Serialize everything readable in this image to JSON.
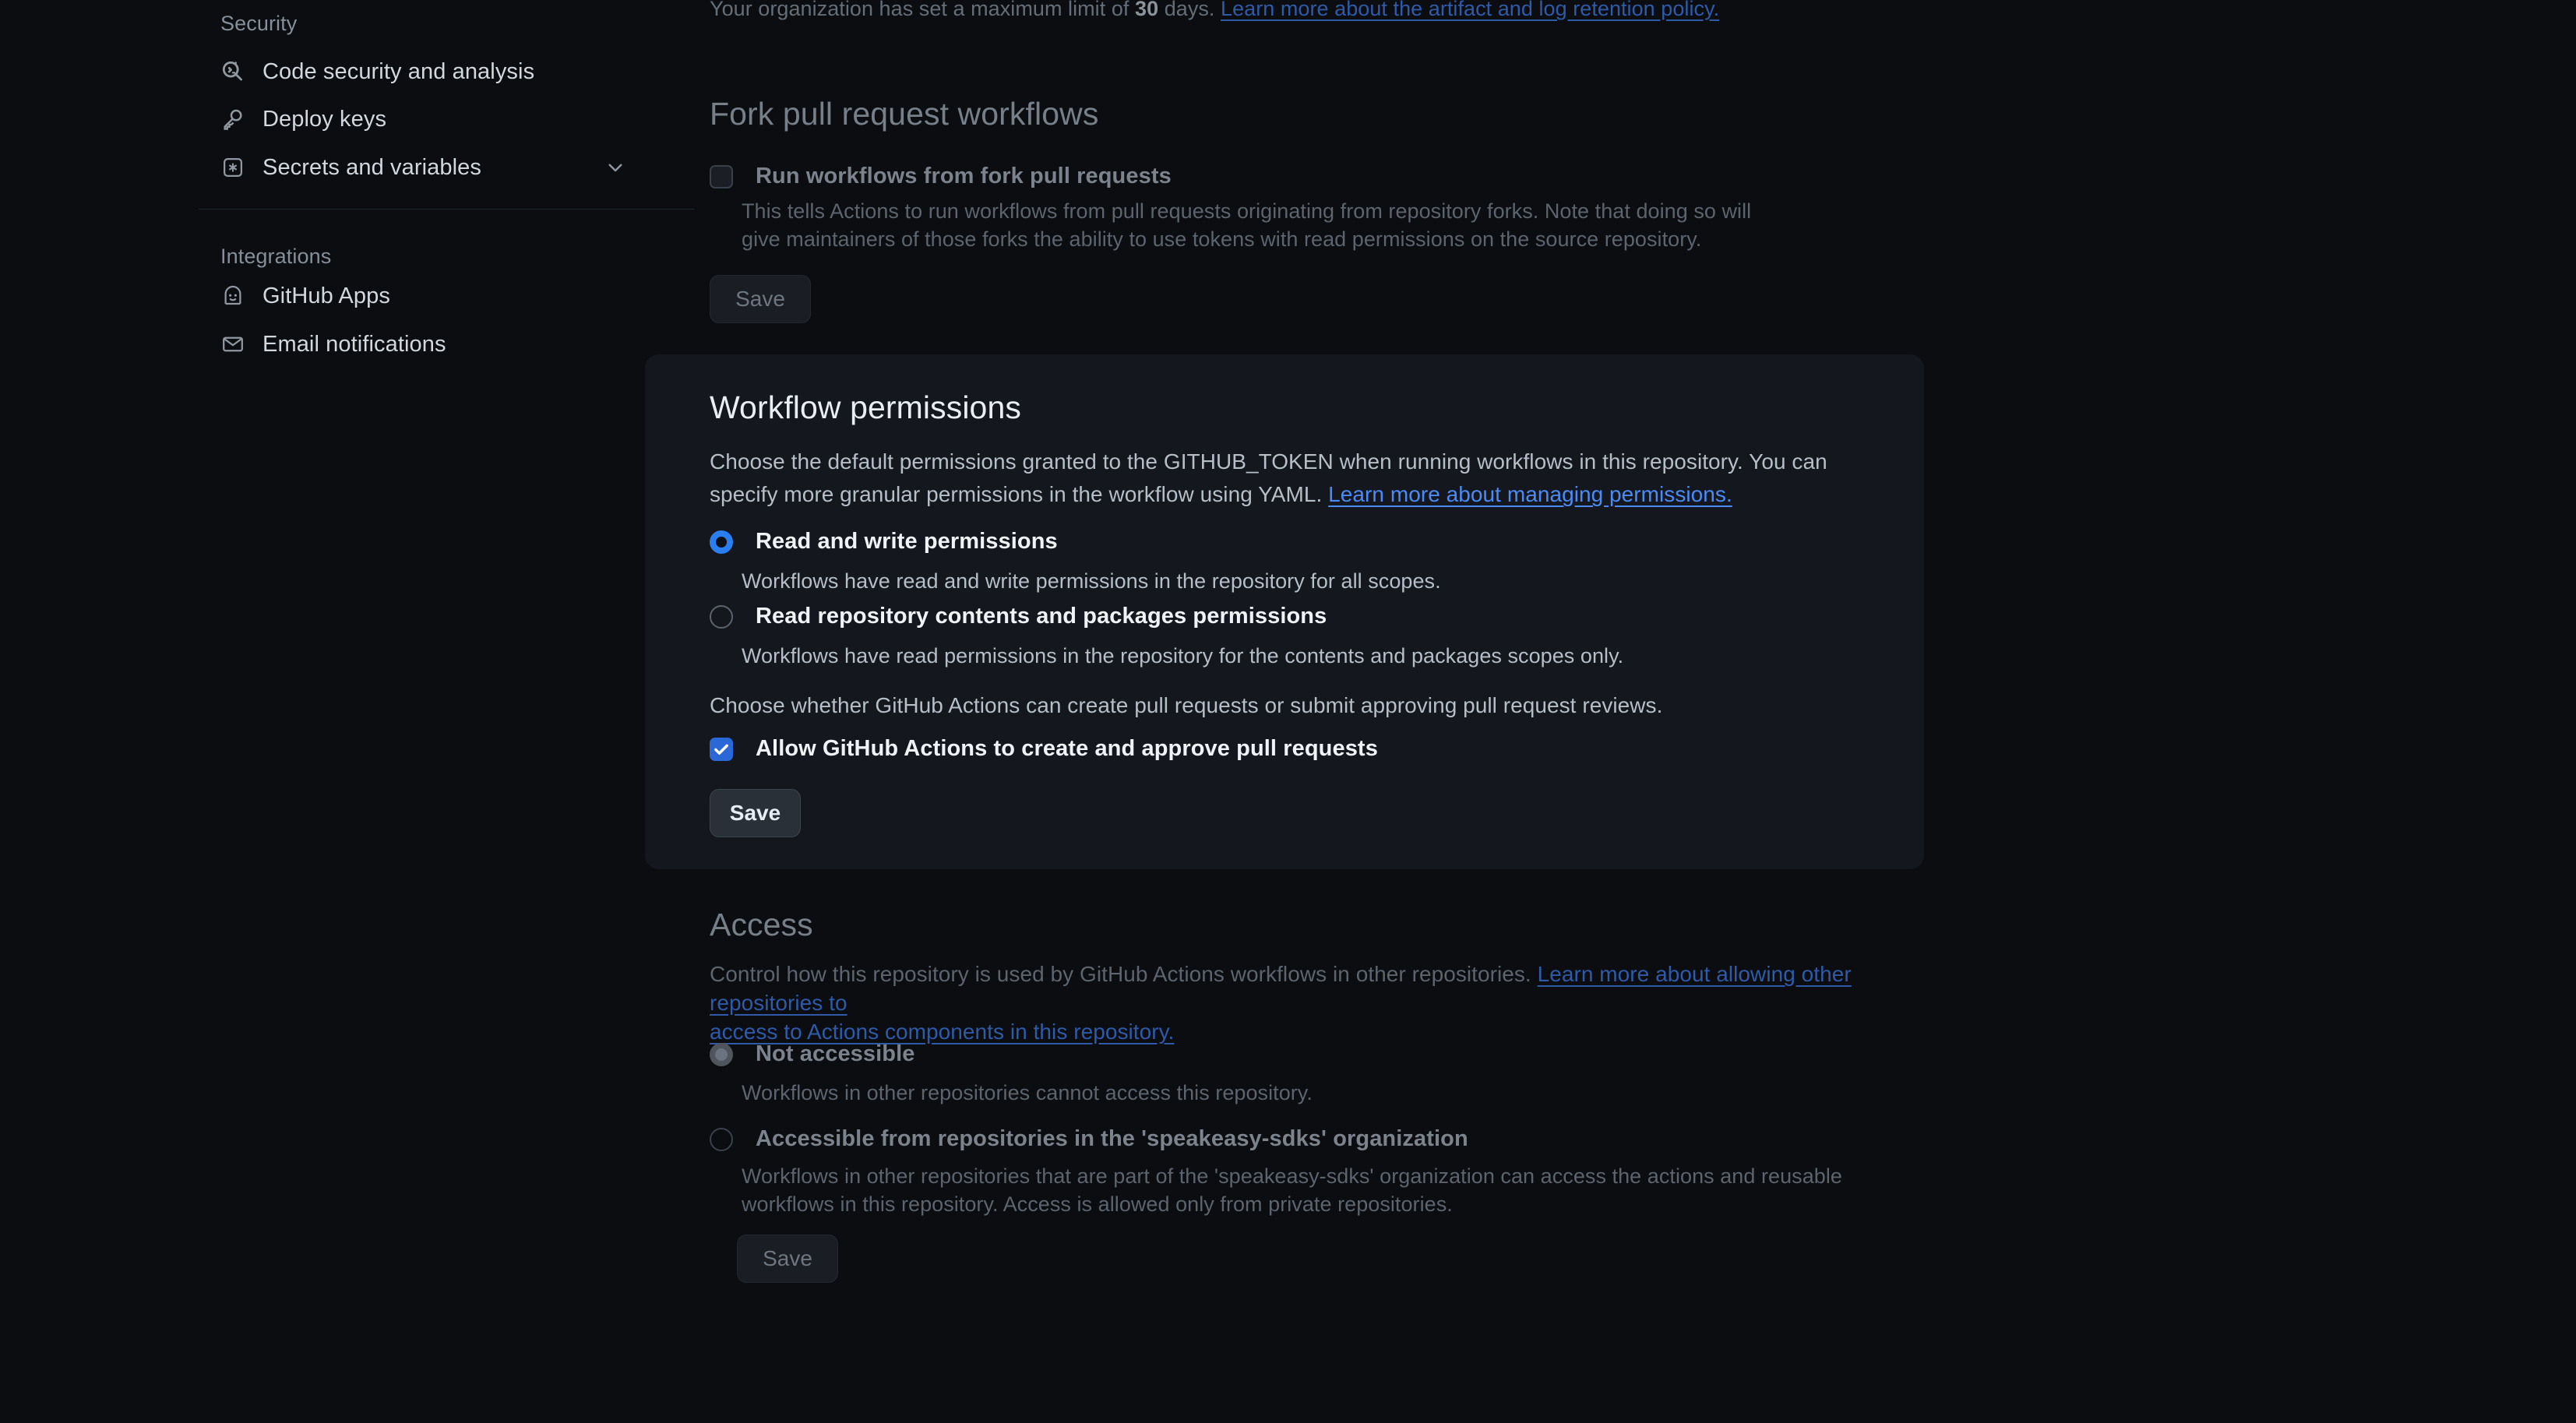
{
  "sidebar": {
    "groups": [
      {
        "title": "Security",
        "items": [
          {
            "label": "Code security and analysis",
            "icon": "code-scan-icon",
            "expandable": false
          },
          {
            "label": "Deploy keys",
            "icon": "key-icon",
            "expandable": false
          },
          {
            "label": "Secrets and variables",
            "icon": "asterisk-key-icon",
            "expandable": true
          }
        ]
      },
      {
        "title": "Integrations",
        "items": [
          {
            "label": "GitHub Apps",
            "icon": "github-app-icon",
            "expandable": false
          },
          {
            "label": "Email notifications",
            "icon": "mail-icon",
            "expandable": false
          }
        ]
      }
    ]
  },
  "retention": {
    "text_before": "Your organization has set a maximum limit of ",
    "days": "30",
    "text_after": " days. ",
    "link": "Learn more about the artifact and log retention policy."
  },
  "fork_section": {
    "heading": "Fork pull request workflows",
    "checkbox_label": "Run workflows from fork pull requests",
    "checkbox_checked": false,
    "description_line1": "This tells Actions to run workflows from pull requests originating from repository forks. Note that doing so will",
    "description_line2": "give maintainers of those forks the ability to use tokens with read permissions on the source repository.",
    "save_label": "Save"
  },
  "workflow_permissions": {
    "heading": "Workflow permissions",
    "description_line1": "Choose the default permissions granted to the GITHUB_TOKEN when running workflows in this repository. You can",
    "description_line2_before": "specify more granular permissions in the workflow using YAML. ",
    "description_link": "Learn more about managing permissions.",
    "options": [
      {
        "label": "Read and write permissions",
        "description": "Workflows have read and write permissions in the repository for all scopes.",
        "selected": true
      },
      {
        "label": "Read repository contents and packages permissions",
        "description": "Workflows have read permissions in the repository for the contents and packages scopes only.",
        "selected": false
      }
    ],
    "pr_prompt": "Choose whether GitHub Actions can create pull requests or submit approving pull request reviews.",
    "pr_checkbox_label": "Allow GitHub Actions to create and approve pull requests",
    "pr_checkbox_checked": true,
    "save_label": "Save"
  },
  "access_section": {
    "heading": "Access",
    "description_before": "Control how this repository is used by GitHub Actions workflows in other repositories. ",
    "description_link_line1": "Learn more about allowing other repositories to",
    "description_link_line2": "access to Actions components in this repository.",
    "options": [
      {
        "label": "Not accessible",
        "description_line1": "Workflows in other repositories cannot access this repository.",
        "description_line2": "",
        "selected": true
      },
      {
        "label": "Accessible from repositories in the 'speakeasy-sdks' organization",
        "description_line1": "Workflows in other repositories that are part of the 'speakeasy-sdks' organization can access the actions and reusable workflows in",
        "description_line2": "this repository. Access is allowed only from private repositories.",
        "selected": false
      }
    ],
    "save_label": "Save"
  },
  "colors": {
    "page_background": "#0b0d11",
    "panel_background": "#14181e",
    "accent_blue": "#2a7ef0",
    "checkbox_blue": "#2a68d8",
    "link_blue": "#4c8bf5",
    "link_dim_blue": "#2f5aa8"
  }
}
